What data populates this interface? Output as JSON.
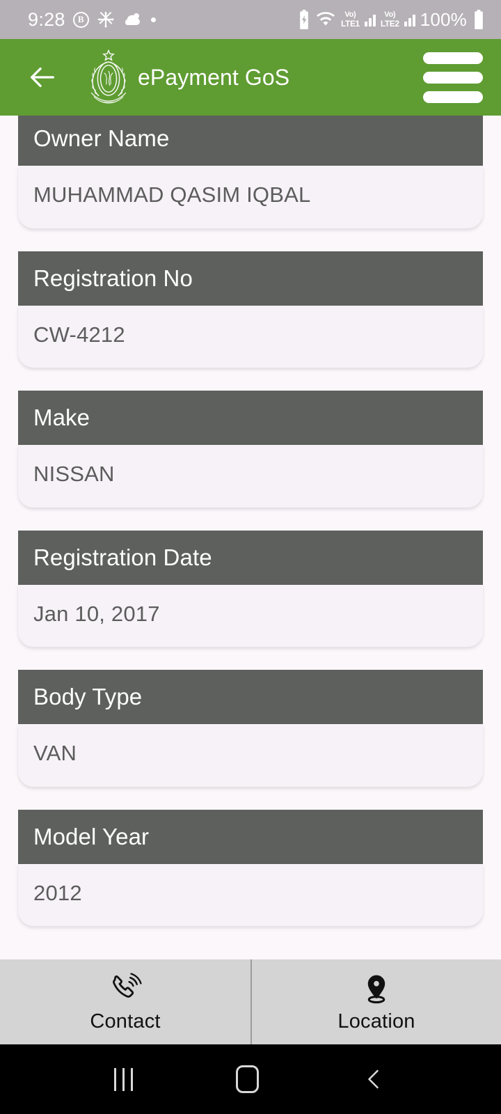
{
  "status_bar": {
    "time": "9:28",
    "badge_letter": "B",
    "battery_percent": "100%",
    "network_1": {
      "vo": "Vo)",
      "lte": "LTE1"
    },
    "network_2": {
      "vo": "Vo)",
      "lte": "LTE2"
    },
    "icons": [
      "bixby-badge-icon",
      "snowflake-icon",
      "weather-cloud-icon",
      "dot-icon",
      "battery-charging-icon",
      "wifi-icon",
      "signal-bars-icon",
      "battery-icon"
    ]
  },
  "app_bar": {
    "title": "ePayment GoS",
    "back_label": "Back",
    "menu_label": "Menu",
    "emblem_label": "Government of Sindh emblem",
    "background_color": "#5F9C32"
  },
  "theme": {
    "accent_green": "#5F9C32",
    "header_gray": "#5D605C",
    "card_body": "#F7F2F8",
    "page_background": "#FBF7FB",
    "bottom_bar": "#D5D4D5"
  },
  "vehicle_details": [
    {
      "label": "Owner Name",
      "value": "MUHAMMAD QASIM IQBAL"
    },
    {
      "label": "Registration No",
      "value": "CW-4212"
    },
    {
      "label": "Make",
      "value": "NISSAN"
    },
    {
      "label": "Registration Date",
      "value": "Jan 10, 2017"
    },
    {
      "label": "Body Type",
      "value": "VAN"
    },
    {
      "label": "Model Year",
      "value": "2012"
    }
  ],
  "bottom_bar": {
    "items": [
      {
        "label": "Contact",
        "icon": "phone-ringing-icon"
      },
      {
        "label": "Location",
        "icon": "map-pin-icon"
      }
    ]
  },
  "android_nav": {
    "recents_label": "Recents",
    "home_label": "Home",
    "back_label": "Back"
  }
}
